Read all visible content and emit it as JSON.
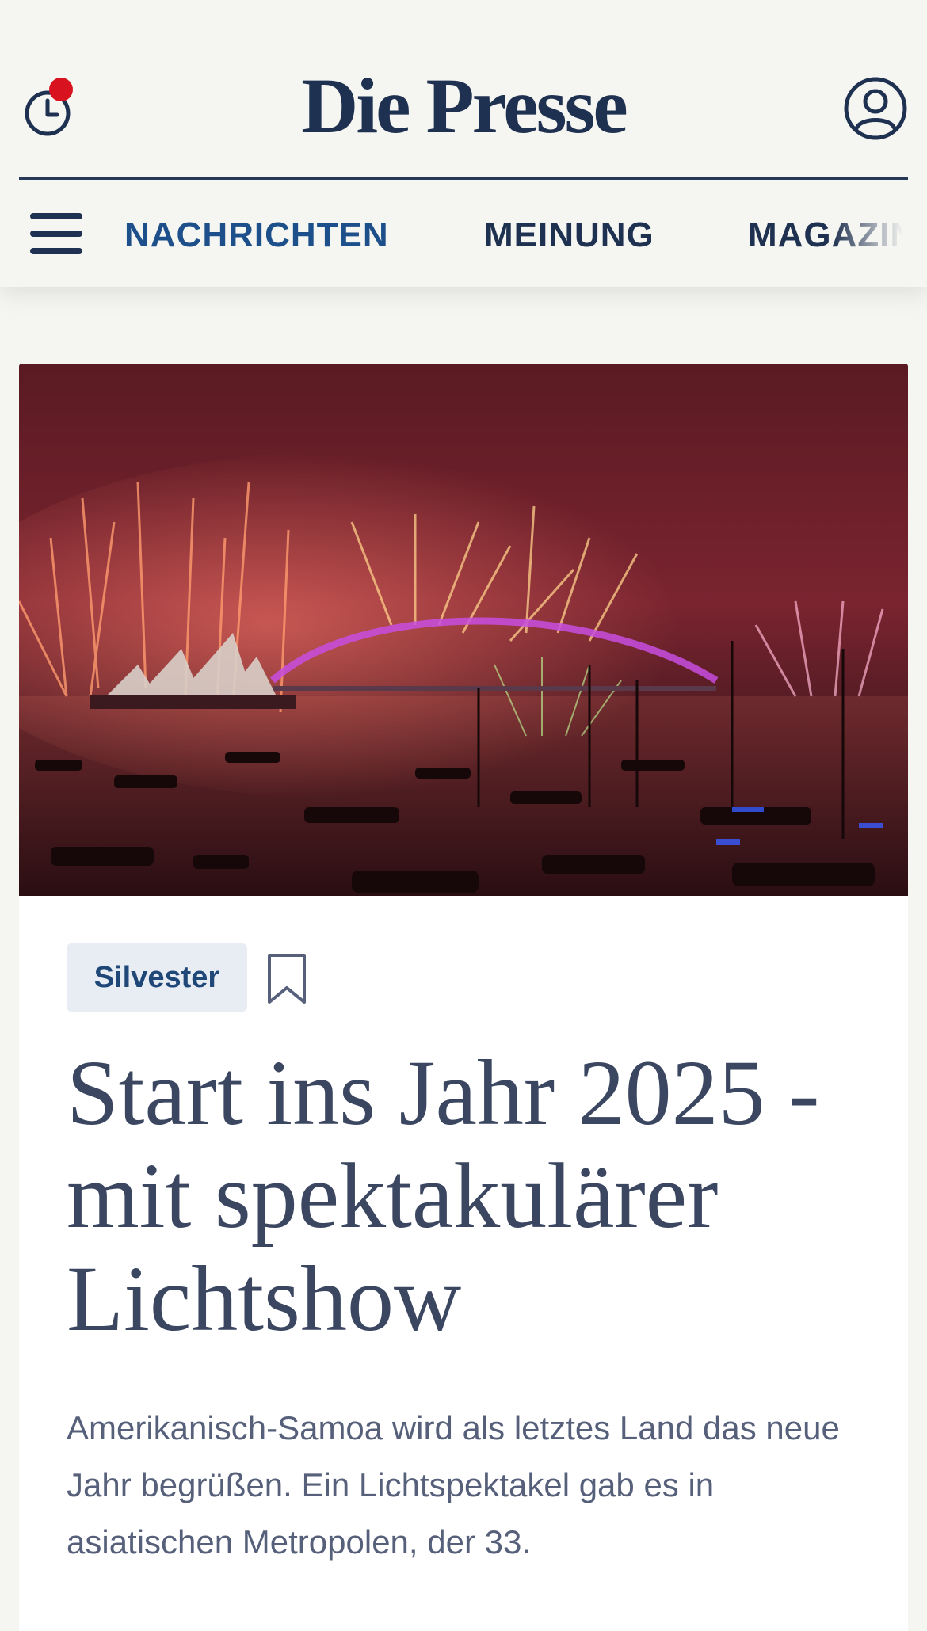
{
  "header": {
    "logo": "Die Presse",
    "icons": {
      "history": "clock-icon",
      "account": "user-circle-icon",
      "menu": "hamburger-menu-icon"
    }
  },
  "nav": {
    "items": [
      {
        "label": "NACHRICHTEN",
        "active": true
      },
      {
        "label": "MEINUNG",
        "active": false
      },
      {
        "label": "MAGAZIN",
        "active": false
      }
    ]
  },
  "article": {
    "image": "Feuerwerk über Oper und Brücke bei Nacht",
    "tag": "Silvester",
    "headline": "Start ins Jahr 2025 - mit spektakulärer Lichtshow",
    "teaser": "Amerikanisch-Samoa wird als letztes Land das neue Jahr begrüßen. Ein Lichtspektakel gab es in asiatischen Metropolen, der 33."
  },
  "colors": {
    "brand": "#1f3150",
    "accent_active": "#1d4f8a",
    "notification": "#d8131f",
    "tag_bg": "#e8edf4",
    "background": "#f5f5f2"
  }
}
